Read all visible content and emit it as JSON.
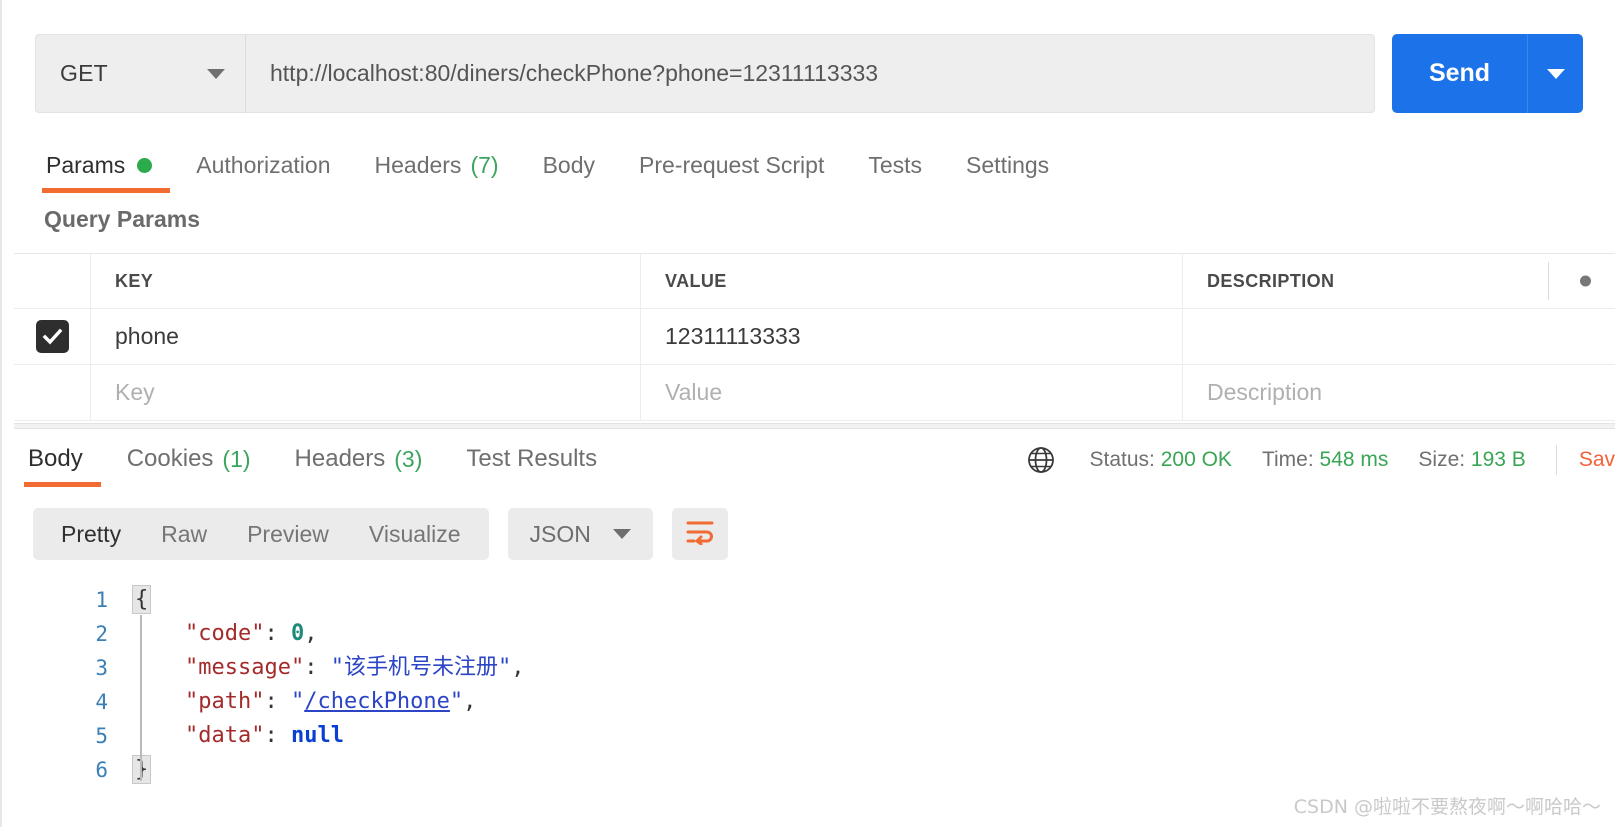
{
  "request": {
    "method": "GET",
    "url": "http://localhost:80/diners/checkPhone?phone=12311113333",
    "send_label": "Send",
    "tabs": [
      {
        "label": "Params",
        "badge": "",
        "dot": true,
        "active": true
      },
      {
        "label": "Authorization",
        "badge": "",
        "dot": false,
        "active": false
      },
      {
        "label": "Headers",
        "badge": "(7)",
        "dot": false,
        "active": false
      },
      {
        "label": "Body",
        "badge": "",
        "dot": false,
        "active": false
      },
      {
        "label": "Pre-request Script",
        "badge": "",
        "dot": false,
        "active": false
      },
      {
        "label": "Tests",
        "badge": "",
        "dot": false,
        "active": false
      },
      {
        "label": "Settings",
        "badge": "",
        "dot": false,
        "active": false
      }
    ]
  },
  "query_params": {
    "section_title": "Query Params",
    "columns": {
      "key": "KEY",
      "value": "VALUE",
      "description": "DESCRIPTION"
    },
    "rows": [
      {
        "checked": true,
        "key": "phone",
        "value": "12311113333",
        "description": ""
      }
    ],
    "placeholder_row": {
      "key": "Key",
      "value": "Value",
      "description": "Description"
    }
  },
  "response": {
    "tabs": [
      {
        "label": "Body",
        "badge": "",
        "active": true
      },
      {
        "label": "Cookies",
        "badge": "(1)",
        "active": false
      },
      {
        "label": "Headers",
        "badge": "(3)",
        "active": false
      },
      {
        "label": "Test Results",
        "badge": "",
        "active": false
      }
    ],
    "status": {
      "label": "Status:",
      "value": "200 OK"
    },
    "time": {
      "label": "Time:",
      "value": "548 ms"
    },
    "size": {
      "label": "Size:",
      "value": "193 B"
    },
    "save_response": "Sav",
    "view_modes": [
      {
        "label": "Pretty",
        "active": true
      },
      {
        "label": "Raw",
        "active": false
      },
      {
        "label": "Preview",
        "active": false
      },
      {
        "label": "Visualize",
        "active": false
      }
    ],
    "format": "JSON",
    "body": {
      "language": "json",
      "line_numbers": [
        "1",
        "2",
        "3",
        "4",
        "5",
        "6"
      ],
      "lines": [
        {
          "n": "1",
          "tokens": [
            {
              "t": "brace",
              "v": "{"
            }
          ]
        },
        {
          "n": "2",
          "tokens": [
            {
              "t": "plain",
              "v": "    "
            },
            {
              "t": "key",
              "v": "\"code\""
            },
            {
              "t": "punct",
              "v": ": "
            },
            {
              "t": "num",
              "v": "0"
            },
            {
              "t": "punct",
              "v": ","
            }
          ]
        },
        {
          "n": "3",
          "tokens": [
            {
              "t": "plain",
              "v": "    "
            },
            {
              "t": "key",
              "v": "\"message\""
            },
            {
              "t": "punct",
              "v": ": "
            },
            {
              "t": "str",
              "v": "\"该手机号未注册\""
            },
            {
              "t": "punct",
              "v": ","
            }
          ]
        },
        {
          "n": "4",
          "tokens": [
            {
              "t": "plain",
              "v": "    "
            },
            {
              "t": "key",
              "v": "\"path\""
            },
            {
              "t": "punct",
              "v": ": "
            },
            {
              "t": "str",
              "v": "\""
            },
            {
              "t": "link",
              "v": "/checkPhone"
            },
            {
              "t": "str",
              "v": "\""
            },
            {
              "t": "punct",
              "v": ","
            }
          ]
        },
        {
          "n": "5",
          "tokens": [
            {
              "t": "plain",
              "v": "    "
            },
            {
              "t": "key",
              "v": "\"data\""
            },
            {
              "t": "punct",
              "v": ": "
            },
            {
              "t": "null",
              "v": "null"
            }
          ]
        },
        {
          "n": "6",
          "tokens": [
            {
              "t": "brace",
              "v": "}"
            }
          ]
        }
      ]
    }
  },
  "watermark": "CSDN @啦啦不要熬夜啊～啊哈哈～",
  "colors": {
    "accent_orange": "#f26b33",
    "send_blue": "#1c72e8",
    "success_green": "#3aa655",
    "save_orange": "#f4623a",
    "json_key": "#a42b2b",
    "json_string": "#2b45c6",
    "json_number": "#1d8a7a",
    "json_null": "#0b3fd4"
  }
}
